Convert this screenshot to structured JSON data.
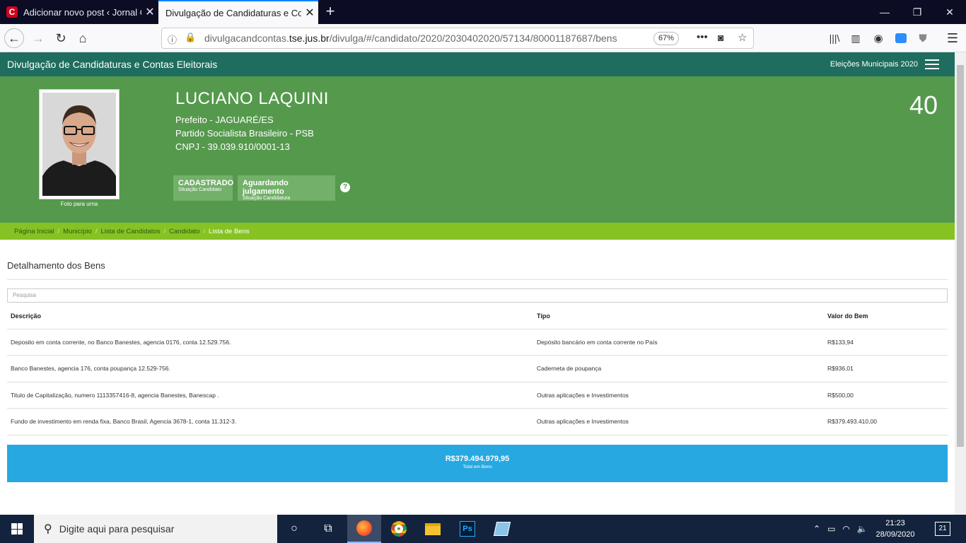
{
  "browser": {
    "tabs": [
      {
        "title": "Adicionar novo post ‹ Jornal O"
      },
      {
        "title": "Divulgação de Candidaturas e Cont"
      }
    ],
    "url_prefix": "divulgacandcontas.",
    "url_domain": "tse.jus.br",
    "url_path": "/divulga/#/candidato/2020/2030402020/57134/80001187687/bens",
    "zoom": "67%"
  },
  "site": {
    "title": "Divulgação de Candidaturas e Contas Eleitorais",
    "election": "Eleições Municipais 2020"
  },
  "candidate": {
    "name": "LUCIANO LAQUINI",
    "office": "Prefeito - JAGUARÉ/ES",
    "party": "Partido Socialista Brasileiro - PSB",
    "cnpj": "CNPJ - 39.039.910/0001-13",
    "number": "40",
    "photo_caption": "Foto para urna",
    "status": [
      {
        "value": "CADASTRADO",
        "label": "Situação Candidato"
      },
      {
        "value": "Aguardando julgamento",
        "label": "Situação Candidatura"
      }
    ],
    "help": "?"
  },
  "breadcrumb": [
    {
      "label": "Página Inicial"
    },
    {
      "label": "Município"
    },
    {
      "label": "Lista de Candidatos"
    },
    {
      "label": "Candidato"
    },
    {
      "label": "Lista de Bens"
    }
  ],
  "assets": {
    "title": "Detalhamento dos Bens",
    "search_placeholder": "Pesquisa",
    "columns": [
      "Descrição",
      "Tipo",
      "Valor do Bem"
    ],
    "rows": [
      {
        "descricao": "Deposito em conta corrente, no Banco Banestes, agencia 0176, conta 12.529.756.",
        "tipo": "Depósito bancário em conta corrente no País",
        "valor": "R$133,94"
      },
      {
        "descricao": "Banco Banestes, agencia 176, conta poupança 12.529-756.",
        "tipo": "Caderneta de poupança",
        "valor": "R$936,01"
      },
      {
        "descricao": "Titulo de Capitalização, numero 1113357416-8, agencia Banestes, Banescap .",
        "tipo": "Outras aplicações e Investimentos",
        "valor": "R$500,00"
      },
      {
        "descricao": "Fundo de investimento em renda fixa, Banco Brasil, Agencia 3678-1, conta 11.312-3.",
        "tipo": "Outras aplicações e Investimentos",
        "valor": "R$379.493.410,00"
      }
    ],
    "total_value": "R$379.494.979,95",
    "total_label": "Total em Bens"
  },
  "taskbar": {
    "search_placeholder": "Digite aqui para pesquisar",
    "time": "21:23",
    "date": "28/09/2020",
    "notifications": "21"
  },
  "colors": {
    "site_bar": "#1f6d5e",
    "hero": "#55994d",
    "breadcrumb": "#86c224",
    "total": "#27a8e0"
  }
}
